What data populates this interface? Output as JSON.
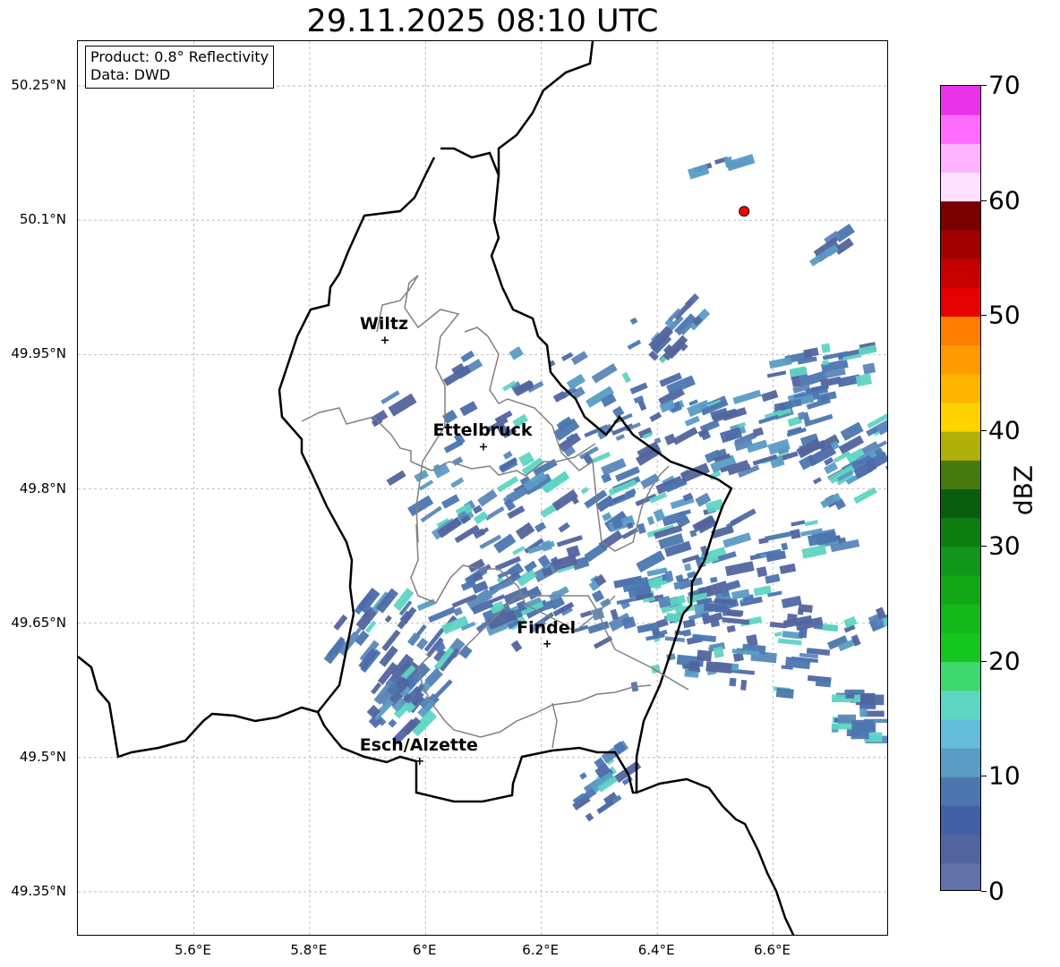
{
  "title": "29.11.2025 08:10 UTC",
  "info_box": {
    "product": "Product: 0.8° Reflectivity",
    "source": "Data: DWD"
  },
  "map": {
    "lon_range": [
      5.4,
      6.8
    ],
    "lat_range": [
      49.3,
      50.3
    ],
    "lon_ticks": [
      {
        "value": 5.6,
        "label": "5.6°E"
      },
      {
        "value": 5.8,
        "label": "5.8°E"
      },
      {
        "value": 6.0,
        "label": "6°E"
      },
      {
        "value": 6.2,
        "label": "6.2°E"
      },
      {
        "value": 6.4,
        "label": "6.4°E"
      },
      {
        "value": 6.6,
        "label": "6.6°E"
      }
    ],
    "lat_ticks": [
      {
        "value": 49.35,
        "label": "49.35°N"
      },
      {
        "value": 49.5,
        "label": "49.5°N"
      },
      {
        "value": 49.65,
        "label": "49.65°N"
      },
      {
        "value": 49.8,
        "label": "49.8°N"
      },
      {
        "value": 49.95,
        "label": "49.95°N"
      },
      {
        "value": 50.1,
        "label": "50.1°N"
      },
      {
        "value": 50.25,
        "label": "50.25°N"
      }
    ],
    "grid": true,
    "grid_style": "dashed",
    "cities": [
      {
        "name": "Wiltz",
        "lon": 5.93,
        "lat": 49.966
      },
      {
        "name": "Ettelbruck",
        "lon": 6.1,
        "lat": 49.847
      },
      {
        "name": "Findel",
        "lon": 6.21,
        "lat": 49.627
      },
      {
        "name": "Esch/Alzette",
        "lon": 5.99,
        "lat": 49.496
      }
    ],
    "radar_site": {
      "lon": 6.55,
      "lat": 50.11,
      "color": "#ff0000"
    }
  },
  "colorbar": {
    "label": "dBZ",
    "min": 0,
    "max": 70,
    "step": 2.5,
    "ticks": [
      0,
      10,
      20,
      30,
      40,
      50,
      60,
      70
    ],
    "colors": [
      "#6270a8",
      "#52649e",
      "#4360a6",
      "#4b76b0",
      "#5a9cc4",
      "#64bddc",
      "#5ed4c2",
      "#3fd86e",
      "#14c61e",
      "#14b81a",
      "#12a716",
      "#10961a",
      "#0e7d12",
      "#085e0c",
      "#467a0c",
      "#afb00a",
      "#ffd200",
      "#ffb400",
      "#ff9a00",
      "#ff7d00",
      "#e60000",
      "#c60000",
      "#a20000",
      "#7a0000",
      "#ffe0ff",
      "#ffb2ff",
      "#ff6cff",
      "#ea34ea"
    ]
  }
}
